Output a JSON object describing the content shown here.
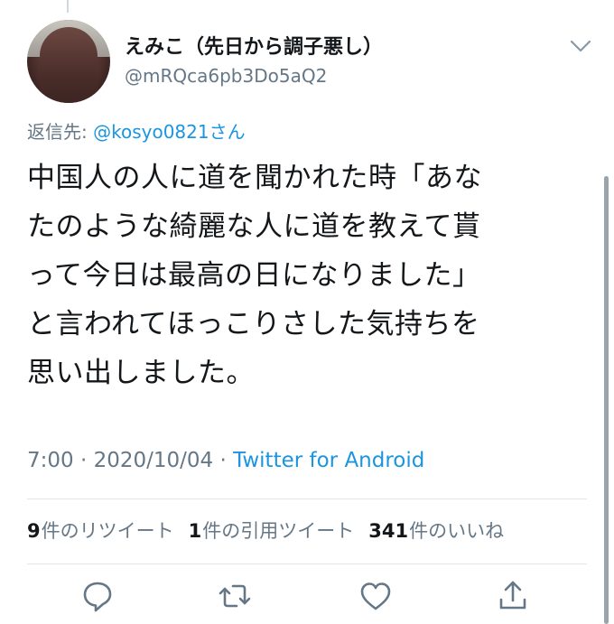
{
  "tweet": {
    "author": {
      "display_name": "えみこ（先日から調子悪し）",
      "handle": "@mRQca6pb3Do5aQ2",
      "avatar_icon": "profile-photo"
    },
    "reply_to": {
      "prefix": "返信先: ",
      "mention": "@kosyo0821さん"
    },
    "text_lines": [
      "中国人の人に道を聞かれた時「あな",
      "たのような綺麗な人に道を教えて貰",
      "って今日は最高の日になりました」",
      "と言われてほっこりさした気持ちを",
      "思い出しました。"
    ],
    "meta": {
      "time": "7:00",
      "sep1": " · ",
      "date": "2020/10/04",
      "sep2": " · ",
      "source": "Twitter for Android"
    },
    "stats": {
      "retweets_count": "9",
      "retweets_label": "件のリツイート",
      "quotes_count": "1",
      "quotes_label": "件の引用ツイート",
      "likes_count": "341",
      "likes_label": "件のいいね"
    },
    "actions": [
      "reply-icon",
      "retweet-icon",
      "like-icon",
      "share-icon"
    ],
    "colors": {
      "link": "#1b95e0",
      "secondary_text": "#657786",
      "primary_text": "#14171a",
      "divider": "#e1e8ed"
    }
  }
}
